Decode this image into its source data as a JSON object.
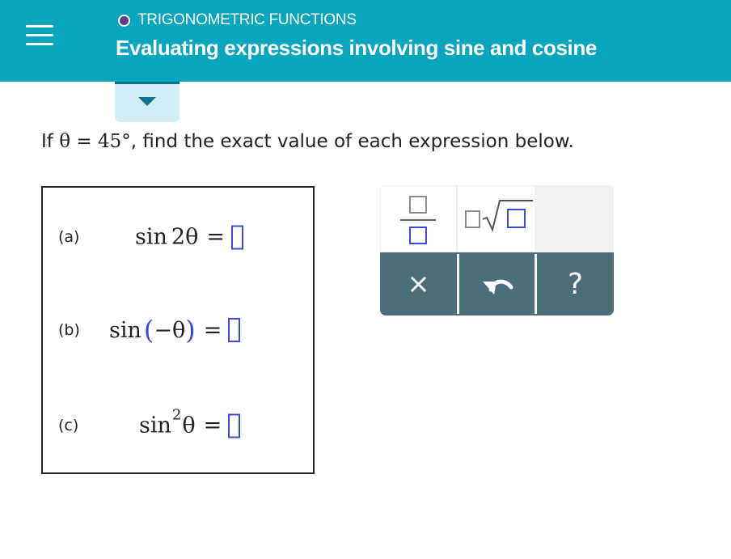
{
  "header": {
    "category": "TRIGONOMETRIC FUNCTIONS",
    "title": "Evaluating expressions involving sine and cosine"
  },
  "question": {
    "prefix": "If",
    "theta": "θ",
    "equals": "=",
    "angle": "45°",
    "suffix": ", find the exact value of each expression below."
  },
  "parts": [
    {
      "label": "(a)",
      "func": "sin",
      "arg": "2θ",
      "equals": "="
    },
    {
      "label": "(b)",
      "func": "sin",
      "open": "(",
      "arg": "−θ",
      "close": ")",
      "equals": "="
    },
    {
      "label": "(c)",
      "func": "sin",
      "power": "2",
      "arg": "θ",
      "equals": "="
    }
  ],
  "toolbar": {
    "clear_symbol": "×",
    "help_symbol": "?",
    "icons": [
      "fraction-icon",
      "nth-root-icon",
      "clear-icon",
      "undo-icon",
      "help-icon"
    ]
  },
  "colors": {
    "header_bg": "#08a5bf",
    "category_dot": "#5b3f8f",
    "toggle_bg": "#d0eef4",
    "slot_border": "#3c4ad6",
    "toolbar_dark": "#4a6e7a"
  }
}
